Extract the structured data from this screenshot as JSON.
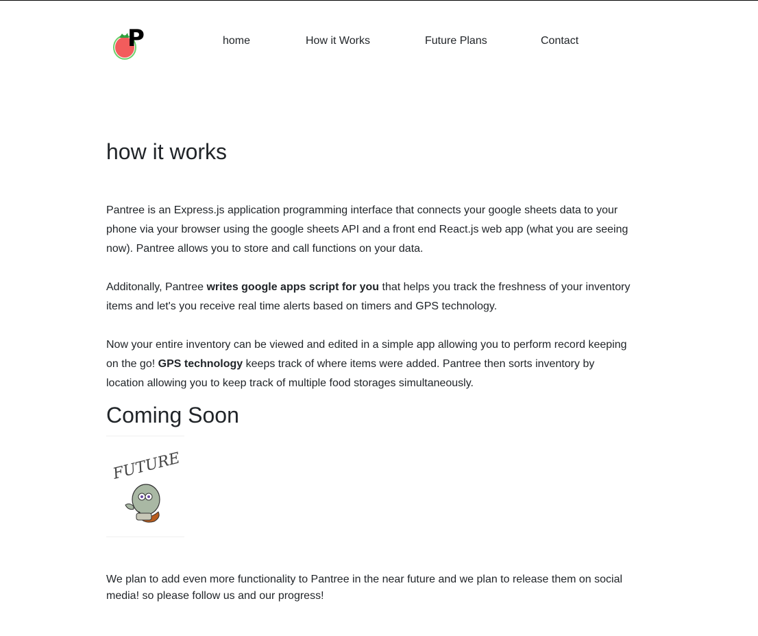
{
  "brand": {
    "logo_letter": "P",
    "logo_name": "pantree-logo"
  },
  "nav": {
    "items": [
      {
        "label": "home"
      },
      {
        "label": "How it Works"
      },
      {
        "label": "Future Plans"
      },
      {
        "label": "Contact"
      }
    ]
  },
  "main": {
    "title": "how it works",
    "para1": "Pantree is an Express.js application programming interface that connects your google sheets data to your phone via your browser using the google sheets API and a front end React.js web app (what you are seeing now). Pantree allows you to store and call functions on your data.",
    "para2": {
      "before": "Additonally, Pantree ",
      "bold": "writes google apps script for you",
      "after": " that helps you track the freshness of your inventory items and let's you receive real time alerts based on timers and GPS technology."
    },
    "para3": {
      "before": "Now your entire inventory can be viewed and edited in a simple app allowing you to perform record keeping on the go! ",
      "bold": "GPS technology",
      "after": " keeps track of where items were added. Pantree then sorts inventory by location allowing you to keep track of multiple food storages simultaneously."
    },
    "coming_soon": "Coming Soon",
    "future_image": {
      "caption": "FUTURE"
    },
    "bottom_text": "We plan to add even more functionality to Pantree in the near future and we plan to release them on social media! so please follow us and our progress!"
  },
  "colors": {
    "text": "#212529",
    "logo_red": "#f25c5c",
    "logo_green": "#6bcf6b",
    "top_border": "#000000"
  }
}
